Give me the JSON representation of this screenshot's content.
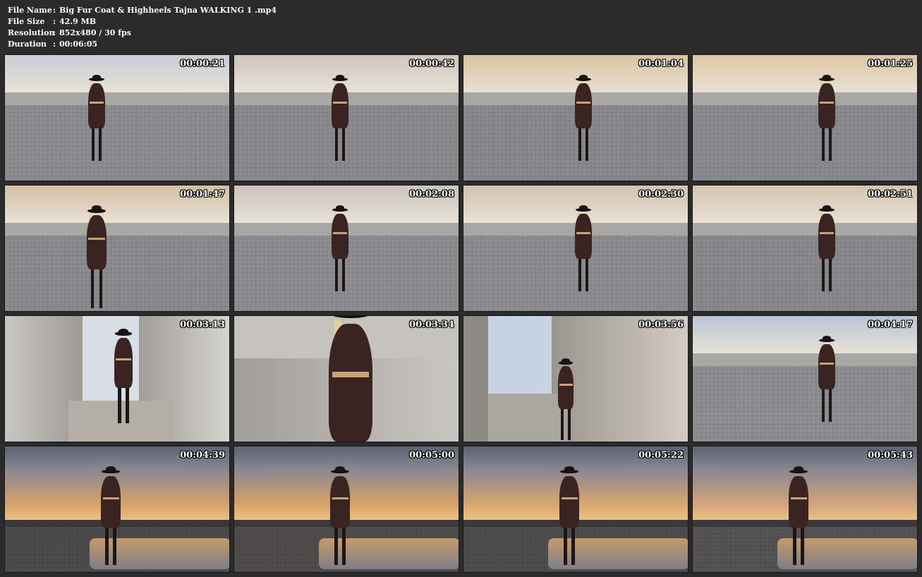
{
  "file_info": {
    "rows": [
      {
        "label": "File Name",
        "sep": ":",
        "value": "Big Fur Coat & Highheels Tajna WALKING 1 .mp4"
      },
      {
        "label": "File Size",
        "sep": ":",
        "value": "42.9 MB"
      },
      {
        "label": "Resolution",
        "sep": ":",
        "value": "852x480 / 30 fps"
      },
      {
        "label": "Duration",
        "sep": ":",
        "value": "00:06:05"
      }
    ]
  },
  "thumbnails": [
    {
      "time": "00:00:21",
      "scene": "plaza-day",
      "sky": "#c9cdd6",
      "ground": "#8e8e92"
    },
    {
      "time": "00:00:42",
      "scene": "plaza-day",
      "sky": "#cfc6bd",
      "ground": "#8b8b8f"
    },
    {
      "time": "00:01:04",
      "scene": "plaza-warm",
      "sky": "#d8c3a0",
      "ground": "#8a8a8e"
    },
    {
      "time": "00:01:25",
      "scene": "plaza-warm",
      "sky": "#dcc6a2",
      "ground": "#8a8b90"
    },
    {
      "time": "00:01:47",
      "scene": "plaza-close",
      "sky": "#d3c0a4",
      "ground": "#8c8c90"
    },
    {
      "time": "00:02:08",
      "scene": "plaza-day",
      "sky": "#cbc4bd",
      "ground": "#8e8e92"
    },
    {
      "time": "00:02:30",
      "scene": "plaza-day",
      "sky": "#cfc2b0",
      "ground": "#8d8d91"
    },
    {
      "time": "00:02:51",
      "scene": "plaza-fountain",
      "sky": "#d6c4ad",
      "ground": "#8a8a8e"
    },
    {
      "time": "00:03:13",
      "scene": "corridor",
      "sky": "#d9dde4",
      "ground": "#a4a09a"
    },
    {
      "time": "00:03:34",
      "scene": "closeup",
      "sky": "#c6c3bf",
      "ground": "#a9a6a1"
    },
    {
      "time": "00:03:56",
      "scene": "corridor-side",
      "sky": "#c7d3e2",
      "ground": "#9f9b95"
    },
    {
      "time": "00:04:17",
      "scene": "buildings",
      "sky": "#b9c5d3",
      "ground": "#8f8f93"
    },
    {
      "time": "00:04:39",
      "scene": "sunset",
      "sky": "#d7a26b",
      "ground": "#4d4b4c"
    },
    {
      "time": "00:05:00",
      "scene": "sunset",
      "sky": "#d8a367",
      "ground": "#4f4c4b"
    },
    {
      "time": "00:05:22",
      "scene": "sunset",
      "sky": "#d9a76d",
      "ground": "#4e4c4c"
    },
    {
      "time": "00:05:43",
      "scene": "sunset",
      "sky": "#d4a57a",
      "ground": "#555355"
    }
  ]
}
